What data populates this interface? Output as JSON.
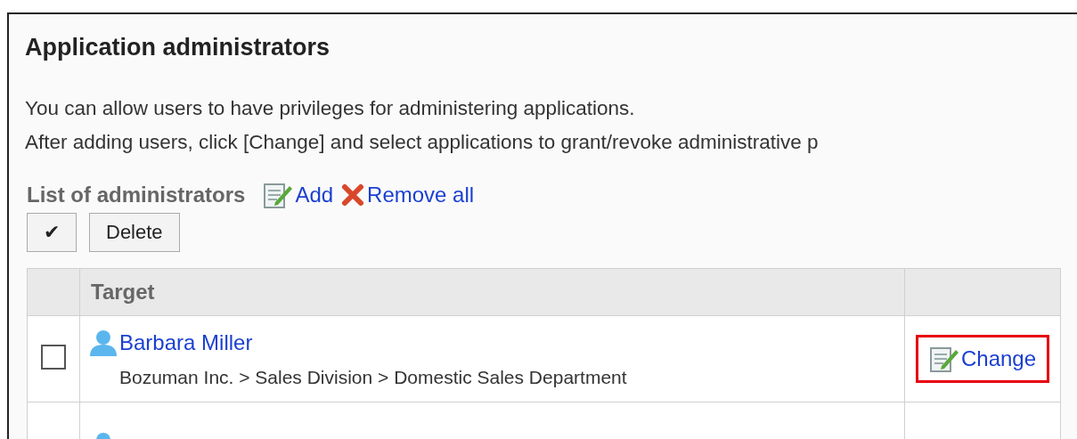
{
  "title": "Application administrators",
  "description": [
    "You can allow users to have privileges for administering applications.",
    "After adding users, click [Change] and select applications to grant/revoke administrative p"
  ],
  "list": {
    "heading": "List of administrators",
    "actions": [
      {
        "kind": "add",
        "label": "Add"
      },
      {
        "kind": "remove",
        "label": "Remove all"
      }
    ]
  },
  "toolbar": {
    "select_all": "✔",
    "delete": "Delete"
  },
  "table": {
    "columns": [
      "",
      "Target",
      ""
    ],
    "rows": [
      {
        "checked": false,
        "name": "Barbara Miller",
        "path": "Bozuman Inc. > Sales Division > Domestic Sales Department",
        "action": "Change",
        "highlighted": true
      },
      {}
    ]
  }
}
